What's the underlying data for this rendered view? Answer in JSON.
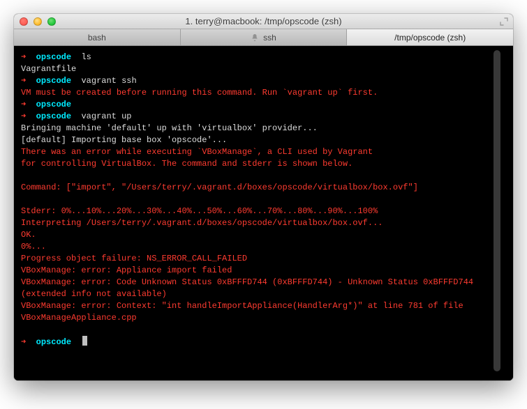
{
  "window": {
    "title": "1. terry@macbook: /tmp/opscode (zsh)"
  },
  "tabs": [
    {
      "label": "bash",
      "active": false,
      "hasBell": false
    },
    {
      "label": "ssh",
      "active": false,
      "hasBell": true
    },
    {
      "label": "/tmp/opscode (zsh)",
      "active": true,
      "hasBell": false
    }
  ],
  "colors": {
    "arrow": "#ff3b30",
    "path": "#00eaff",
    "error": "#ff3b30",
    "text": "#dcdcdc"
  },
  "prompt": {
    "arrow": "➜",
    "path": "opscode"
  },
  "session": [
    {
      "type": "prompt",
      "cmd": "ls"
    },
    {
      "type": "out",
      "text": "Vagrantfile"
    },
    {
      "type": "prompt",
      "cmd": "vagrant ssh"
    },
    {
      "type": "err",
      "text": "VM must be created before running this command. Run `vagrant up` first."
    },
    {
      "type": "prompt",
      "cmd": ""
    },
    {
      "type": "prompt",
      "cmd": "vagrant up"
    },
    {
      "type": "out",
      "text": "Bringing machine 'default' up with 'virtualbox' provider..."
    },
    {
      "type": "out",
      "text": "[default] Importing base box 'opscode'..."
    },
    {
      "type": "err",
      "text": "There was an error while executing `VBoxManage`, a CLI used by Vagrant"
    },
    {
      "type": "err",
      "text": "for controlling VirtualBox. The command and stderr is shown below."
    },
    {
      "type": "err",
      "text": ""
    },
    {
      "type": "err",
      "text": "Command: [\"import\", \"/Users/terry/.vagrant.d/boxes/opscode/virtualbox/box.ovf\"]"
    },
    {
      "type": "err",
      "text": ""
    },
    {
      "type": "err",
      "text": "Stderr: 0%...10%...20%...30%...40%...50%...60%...70%...80%...90%...100%"
    },
    {
      "type": "err",
      "text": "Interpreting /Users/terry/.vagrant.d/boxes/opscode/virtualbox/box.ovf..."
    },
    {
      "type": "err",
      "text": "OK."
    },
    {
      "type": "err",
      "text": "0%..."
    },
    {
      "type": "err",
      "text": "Progress object failure: NS_ERROR_CALL_FAILED"
    },
    {
      "type": "err",
      "text": "VBoxManage: error: Appliance import failed"
    },
    {
      "type": "err",
      "text": "VBoxManage: error: Code Unknown Status 0xBFFFD744 (0xBFFFD744) - Unknown Status 0xBFFFD744 (extended info not available)"
    },
    {
      "type": "err",
      "text": "VBoxManage: error: Context: \"int handleImportAppliance(HandlerArg*)\" at line 781 of file VBoxManageAppliance.cpp"
    },
    {
      "type": "blank"
    },
    {
      "type": "prompt",
      "cmd": "",
      "cursor": true
    }
  ]
}
